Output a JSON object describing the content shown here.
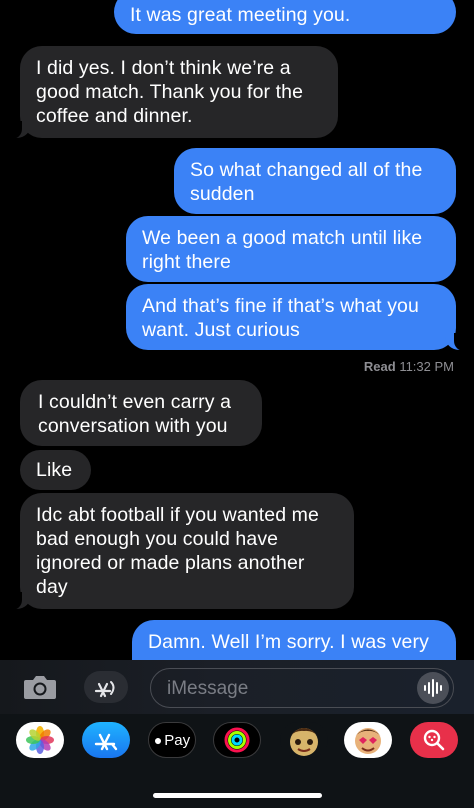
{
  "messages": [
    {
      "text": "It was great meeting you."
    },
    {
      "text": "I did yes. I don’t think we’re a good match. Thank you for the coffee and dinner."
    },
    {
      "text": "So what changed all of the sudden"
    },
    {
      "text": "We been a good match until like right there"
    },
    {
      "text": "And that’s fine if that’s what you want. Just curious"
    },
    {
      "text": "I couldn’t even carry a conversation with you"
    },
    {
      "text": "Like"
    },
    {
      "text": "Idc abt football if you wanted me bad enough you could have ignored or made plans another day"
    },
    {
      "text": "Damn. Well I’m sorry. I was very"
    }
  ],
  "read_receipt": {
    "label": "Read",
    "time": "11:32 PM"
  },
  "compose": {
    "placeholder": "iMessage"
  },
  "tray": {
    "apple_pay_label": "Pay"
  },
  "colors": {
    "outgoing": "#3b82f6",
    "incoming": "#262628",
    "background": "#000000"
  },
  "icons": [
    "camera-icon",
    "app-store-icon",
    "waveform-icon",
    "photos-icon",
    "app-store-icon",
    "apple-pay-icon",
    "activity-icon",
    "memoji-icon",
    "memoji-icon",
    "search-images-icon"
  ]
}
